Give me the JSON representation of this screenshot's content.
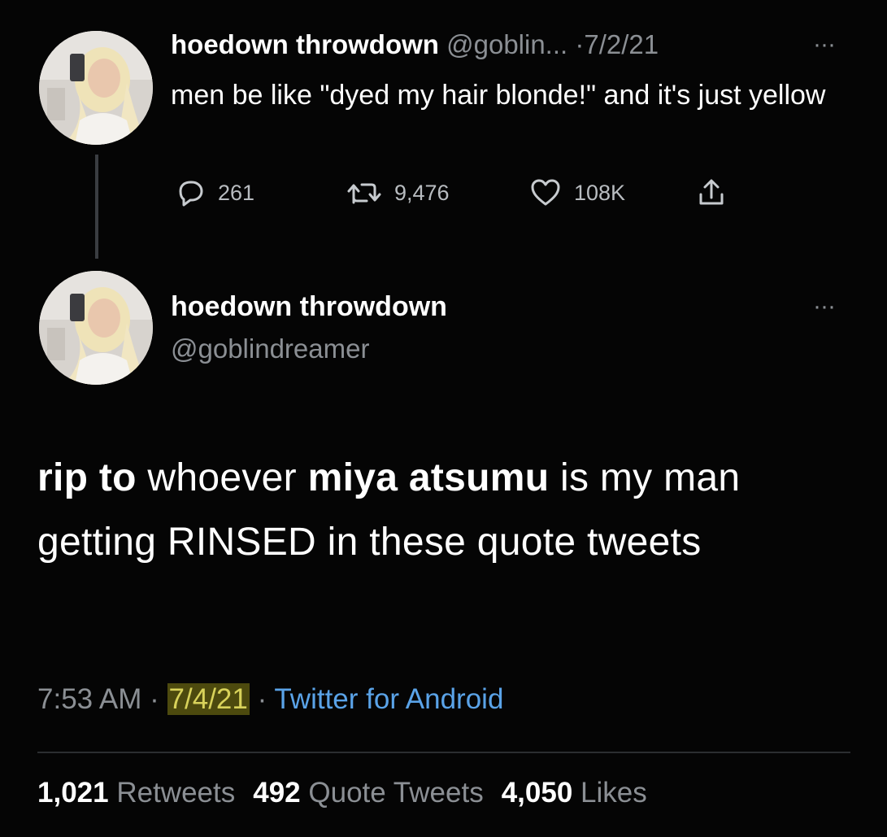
{
  "parent_tweet": {
    "display_name": "hoedown throwdown",
    "handle": "@goblin...",
    "separator": "·",
    "date": "7/2/21",
    "text": "men be like \"dyed my hair blonde!\" and it's just yellow",
    "replies": "261",
    "retweets": "9,476",
    "likes": "108K",
    "more_label": "···",
    "icons": [
      "reply-icon",
      "retweet-icon",
      "like-icon",
      "share-icon"
    ]
  },
  "main_tweet": {
    "display_name": "hoedown throwdown",
    "handle": "@goblindreamer",
    "more_label": "···",
    "text_parts": {
      "p1": "rip to",
      "p2": " whoever ",
      "p3": "miya atsumu",
      "p4": " is my man getting RINSED in these quote tweets"
    },
    "time": "7:53 AM",
    "separator": "·",
    "date": "7/4/21",
    "source": "Twitter for Android",
    "stats": {
      "retweets_count": "1,021",
      "retweets_label": "Retweets",
      "quotes_count": "492",
      "quotes_label": "Quote Tweets",
      "likes_count": "4,050",
      "likes_label": "Likes"
    }
  },
  "colors": {
    "background": "#050505",
    "text": "#ffffff",
    "secondary": "#8b8f94",
    "link": "#5aa3e8",
    "highlight": "#4d4a0e"
  }
}
